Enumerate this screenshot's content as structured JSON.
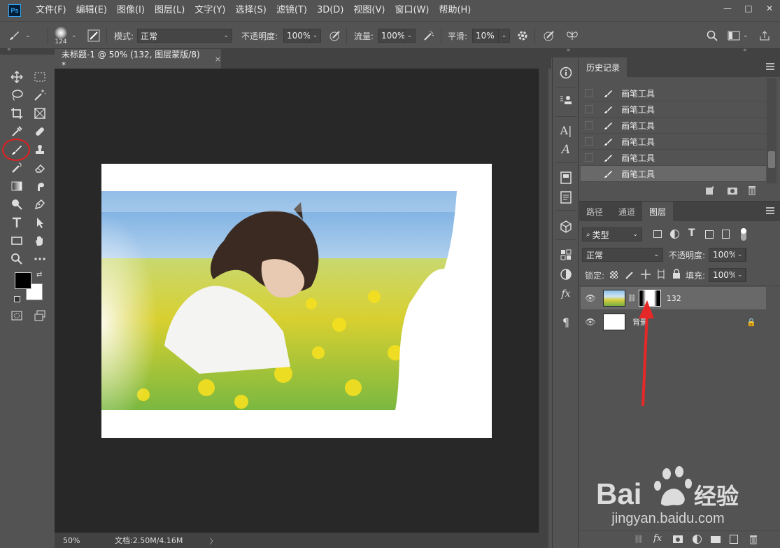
{
  "app": {
    "logo_text": "Ps",
    "menu": [
      "文件(F)",
      "编辑(E)",
      "图像(I)",
      "图层(L)",
      "文字(Y)",
      "选择(S)",
      "滤镜(T)",
      "3D(D)",
      "视图(V)",
      "窗口(W)",
      "帮助(H)"
    ],
    "window_controls": [
      "—",
      "□",
      "✕"
    ]
  },
  "options": {
    "brush_size": "124",
    "mode_label": "模式:",
    "mode_value": "正常",
    "opacity_label": "不透明度:",
    "opacity_value": "100%",
    "flow_label": "流量:",
    "flow_value": "100%",
    "smoothing_label": "平滑:",
    "smoothing_value": "10%"
  },
  "document": {
    "tab_title": "未标题-1 @ 50% (132, 图层蒙版/8) *",
    "close": "×"
  },
  "status": {
    "zoom": "50%",
    "doc_info": "文档:2.50M/4.16M",
    "arrow": "〉"
  },
  "history": {
    "tab": "历史记录",
    "items": [
      {
        "label": "画笔工具",
        "selected": false
      },
      {
        "label": "画笔工具",
        "selected": false
      },
      {
        "label": "画笔工具",
        "selected": false
      },
      {
        "label": "画笔工具",
        "selected": false
      },
      {
        "label": "画笔工具",
        "selected": false
      },
      {
        "label": "画笔工具",
        "selected": true
      }
    ]
  },
  "layers": {
    "tabs": [
      "路径",
      "通道",
      "图层"
    ],
    "active_tab": "图层",
    "filter_kind": "类型",
    "blend_mode": "正常",
    "opacity_label": "不透明度:",
    "opacity_value": "100%",
    "lock_label": "锁定:",
    "fill_label": "填充:",
    "fill_value": "100%",
    "items": [
      {
        "name": "132",
        "selected": true,
        "has_mask": true
      },
      {
        "name": "背景",
        "selected": false,
        "locked": true
      }
    ]
  },
  "watermark": {
    "text": "jingyan.baidu.com"
  },
  "colors": {
    "accent": "#31a8ff",
    "annotation": "#e02020"
  }
}
